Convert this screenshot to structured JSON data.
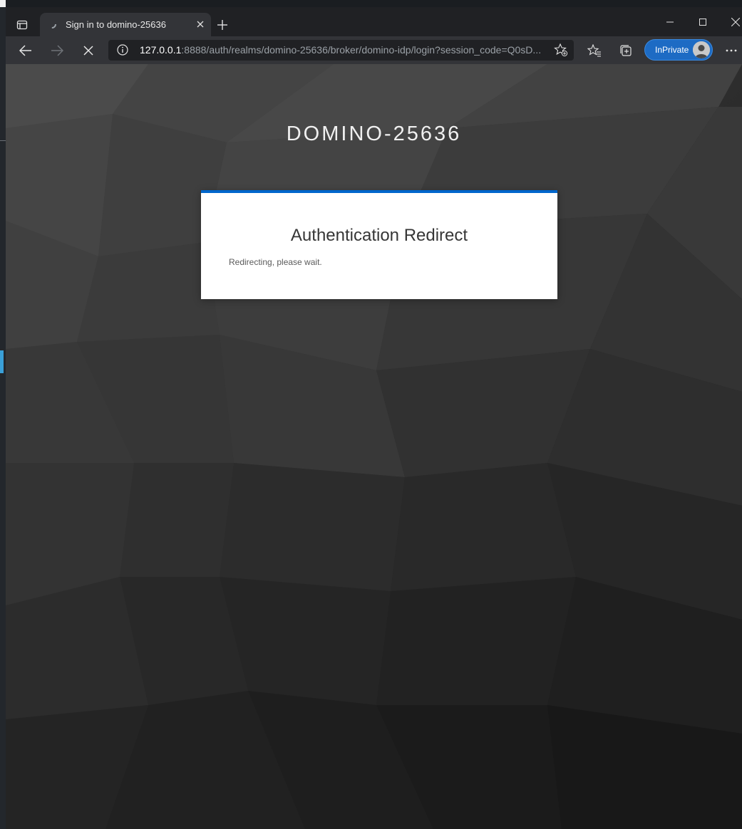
{
  "browser": {
    "tab": {
      "title": "Sign in to domino-25636"
    },
    "address": {
      "host": "127.0.0.1",
      "rest": ":8888/auth/realms/domino-25636/broker/domino-idp/login?session_code=Q0sD..."
    },
    "inprivate_label": "InPrivate",
    "accent": "#1d6bc4"
  },
  "page": {
    "realm_name": "DOMINO-25636",
    "card": {
      "title": "Authentication Redirect",
      "message": "Redirecting, please wait.",
      "accent": "#0066cc"
    }
  }
}
